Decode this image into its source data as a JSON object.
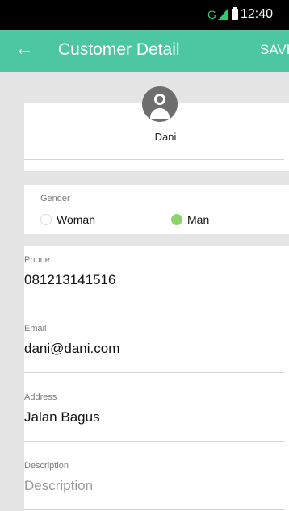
{
  "status_bar": {
    "network": "G",
    "time": "12:40"
  },
  "toolbar": {
    "back_icon": "back-arrow-icon",
    "title": "Customer Detail",
    "save_label": "SAVE"
  },
  "profile": {
    "avatar_icon": "person-avatar-icon",
    "name": "Dani"
  },
  "gender": {
    "label": "Gender",
    "options": [
      {
        "label": "Woman",
        "selected": false
      },
      {
        "label": "Man",
        "selected": true
      }
    ]
  },
  "fields": {
    "phone": {
      "label": "Phone",
      "value": "081213141516"
    },
    "email": {
      "label": "Email",
      "value": "dani@dani.com"
    },
    "address": {
      "label": "Address",
      "value": "Jalan Bagus"
    },
    "description": {
      "label": "Description",
      "placeholder": "Description"
    }
  },
  "colors": {
    "toolbar": "#4cc7a0",
    "radio_selected": "#8bd36a",
    "background": "#e5e5e5"
  }
}
